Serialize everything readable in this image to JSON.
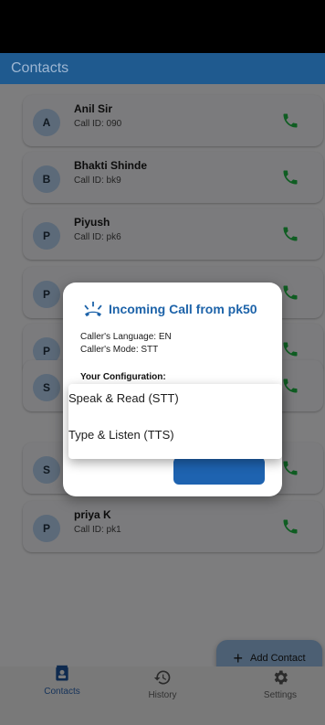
{
  "app": {
    "title": "Contacts"
  },
  "contacts": [
    {
      "initial": "A",
      "name": "Anil Sir",
      "call_id": "Call ID: 090",
      "visible_text": true
    },
    {
      "initial": "B",
      "name": "Bhakti Shinde",
      "call_id": "Call ID: bk9",
      "visible_text": true
    },
    {
      "initial": "P",
      "name": "Piyush",
      "call_id": "Call ID: pk6",
      "visible_text": true
    },
    {
      "initial": "P",
      "name": "",
      "call_id": "",
      "visible_text": false
    },
    {
      "initial": "P",
      "name": "",
      "call_id": "",
      "visible_text": false
    },
    {
      "initial": "S",
      "name": "",
      "call_id": "",
      "visible_text": false
    },
    {
      "initial": "S",
      "name": "",
      "call_id": "",
      "visible_text": false
    },
    {
      "initial": "P",
      "name": "priya K",
      "call_id": "Call ID: pk1",
      "visible_text": true
    }
  ],
  "dialog": {
    "title": "Incoming Call from pk50",
    "caller_language": "Caller's Language: EN",
    "caller_mode": "Caller's Mode: STT",
    "config_label": "Your Configuration:",
    "reject_label": "",
    "accept_label": ""
  },
  "mode_menu": {
    "options": [
      "Speak & Read (STT)",
      "Type & Listen (TTS)"
    ]
  },
  "fab": {
    "plus": "+",
    "label": "Add Contact"
  },
  "bottom_nav": {
    "items": [
      {
        "label": "Contacts",
        "icon": "contacts-icon",
        "active": true
      },
      {
        "label": "History",
        "icon": "history-icon",
        "active": false
      },
      {
        "label": "Settings",
        "icon": "gear-icon",
        "active": false
      }
    ]
  },
  "colors": {
    "primary": "#1e63b0",
    "call_green": "#0f5d22",
    "reject_red": "#c62828"
  }
}
